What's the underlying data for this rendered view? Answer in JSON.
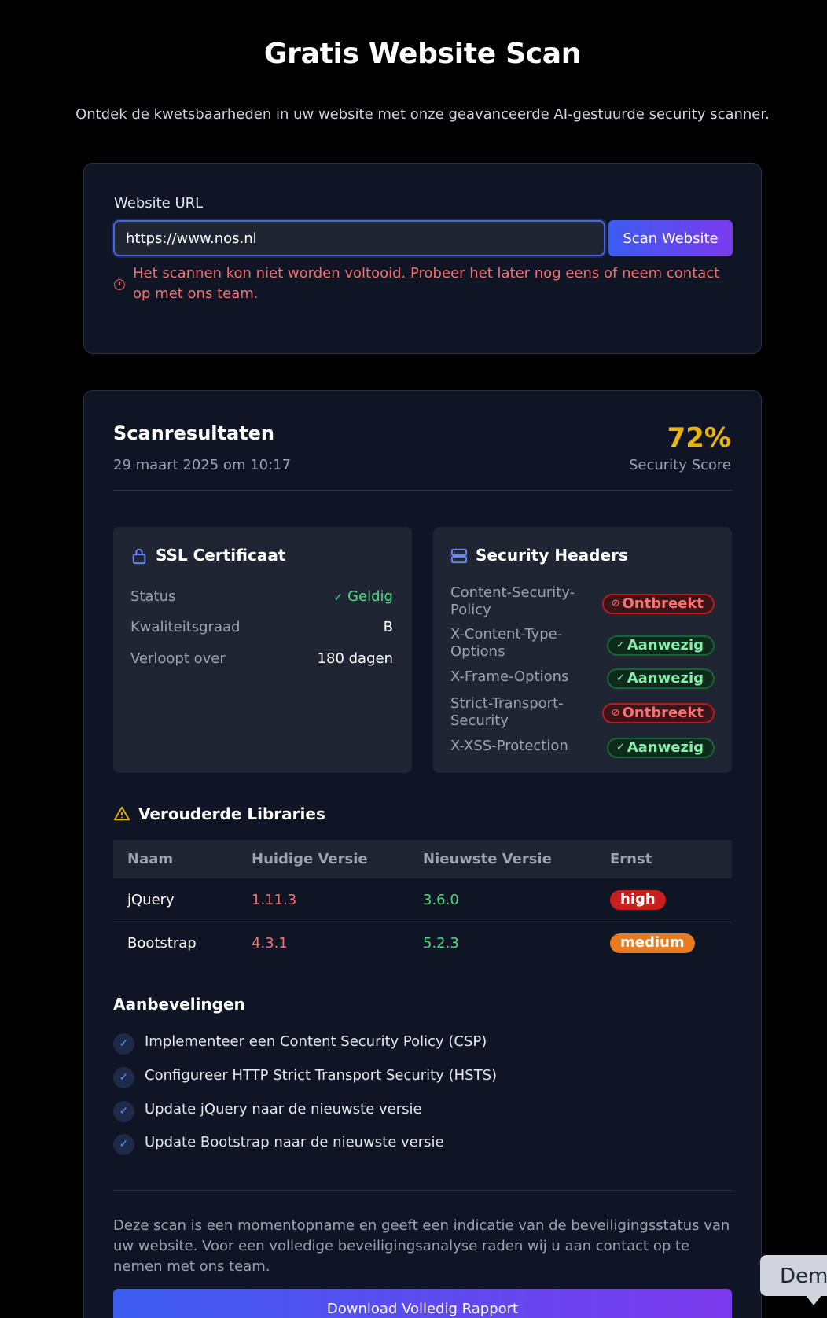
{
  "header": {
    "title": "Gratis Website Scan",
    "subtitle": "Ontdek de kwetsbaarheden in uw website met onze geavanceerde AI-gestuurde security scanner."
  },
  "scan_form": {
    "url_label": "Website URL",
    "url_value": "https://www.nos.nl",
    "scan_button": "Scan Website",
    "error_message": "Het scannen kon niet worden voltooid. Probeer het later nog eens of neem contact op met ons team."
  },
  "results": {
    "title": "Scanresultaten",
    "date": "29 maart 2025 om 10:17",
    "score_value": "72%",
    "score_label": "Security Score",
    "score_color": "#eab308"
  },
  "ssl": {
    "title": "SSL Certificaat",
    "icon": "lock-icon",
    "rows": [
      {
        "label": "Status",
        "value": "Geldig"
      },
      {
        "label": "Kwaliteitsgraad",
        "value": "B"
      },
      {
        "label": "Verloopt over",
        "value": "180 dagen"
      }
    ]
  },
  "security_headers": {
    "title": "Security Headers",
    "icon": "server-icon",
    "items": [
      {
        "name": "Content-Security-Policy",
        "status": "Ontbreekt",
        "state": "missing"
      },
      {
        "name": "X-Content-Type-Options",
        "status": "Aanwezig",
        "state": "present"
      },
      {
        "name": "X-Frame-Options",
        "status": "Aanwezig",
        "state": "present"
      },
      {
        "name": "Strict-Transport-Security",
        "status": "Ontbreekt",
        "state": "missing"
      },
      {
        "name": "X-XSS-Protection",
        "status": "Aanwezig",
        "state": "present"
      }
    ]
  },
  "libraries": {
    "title": "Verouderde Libraries",
    "icon": "warning-icon",
    "columns": [
      "Naam",
      "Huidige Versie",
      "Nieuwste Versie",
      "Ernst"
    ],
    "rows": [
      {
        "name": "jQuery",
        "current": "1.11.3",
        "latest": "3.6.0",
        "severity": "high"
      },
      {
        "name": "Bootstrap",
        "current": "4.3.1",
        "latest": "5.2.3",
        "severity": "medium"
      }
    ]
  },
  "recommendations": {
    "title": "Aanbevelingen",
    "items": [
      "Implementeer een Content Security Policy (CSP)",
      "Configureer HTTP Strict Transport Security (HSTS)",
      "Update jQuery naar de nieuwste versie",
      "Update Bootstrap naar de nieuwste versie"
    ]
  },
  "footer": {
    "disclaimer": "Deze scan is een momentopname en geeft een indicatie van de beveiligingsstatus van uw website. Voor een volledige beveiligingsanalyse raden wij u aan contact op te nemen met ons team.",
    "download_button": "Download Volledig Rapport"
  },
  "demo_bubble": {
    "text": "Dem"
  }
}
